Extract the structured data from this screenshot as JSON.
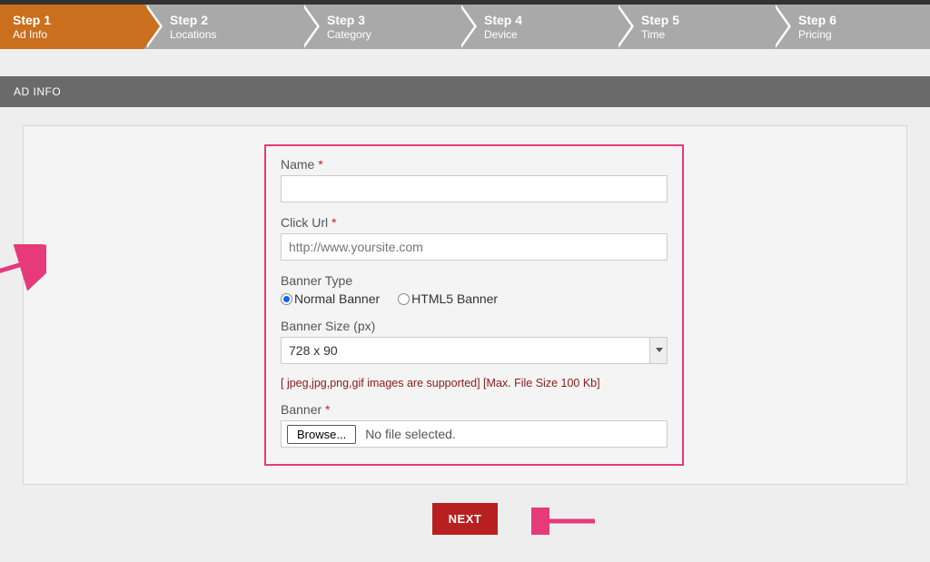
{
  "steps": [
    {
      "title": "Step 1",
      "sub": "Ad Info",
      "active": true
    },
    {
      "title": "Step 2",
      "sub": "Locations",
      "active": false
    },
    {
      "title": "Step 3",
      "sub": "Category",
      "active": false
    },
    {
      "title": "Step 4",
      "sub": "Device",
      "active": false
    },
    {
      "title": "Step 5",
      "sub": "Time",
      "active": false
    },
    {
      "title": "Step 6",
      "sub": "Pricing",
      "active": false
    }
  ],
  "section": {
    "title": "AD INFO"
  },
  "form": {
    "name_label": "Name",
    "name_value": "",
    "click_url_label": "Click Url",
    "click_url_placeholder": "http://www.yoursite.com",
    "click_url_value": "",
    "banner_type_label": "Banner Type",
    "banner_type_options": {
      "normal": "Normal Banner",
      "html5": "HTML5 Banner"
    },
    "banner_type_selected": "normal",
    "banner_size_label": "Banner Size (px)",
    "banner_size_value": "728 x 90",
    "hint": "[ jpeg,jpg,png,gif images are supported] [Max. File Size 100 Kb]",
    "banner_label": "Banner",
    "browse_label": "Browse...",
    "file_status": "No file selected."
  },
  "actions": {
    "next": "NEXT"
  },
  "required_marker": "*"
}
